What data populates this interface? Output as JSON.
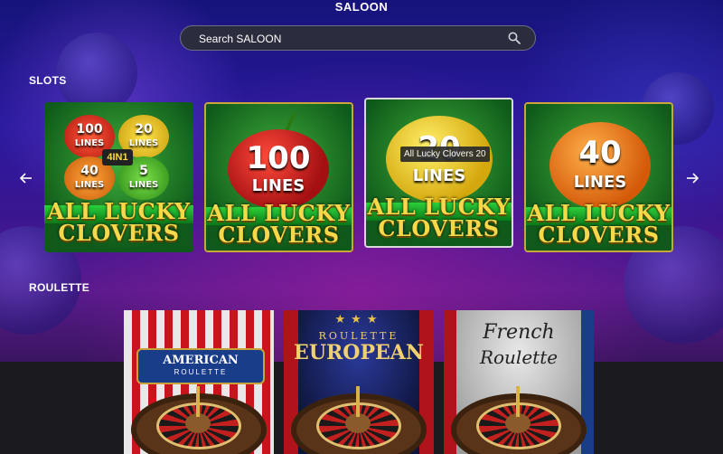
{
  "page_title": "SALOON",
  "search": {
    "placeholder": "Search SALOON"
  },
  "sections": {
    "slots_label": "SLOTS",
    "roulette_label": "ROULETTE"
  },
  "slots": [
    {
      "name": "All Lucky Clovers 5",
      "logo_line1": "ALL LUCKY",
      "logo_line2": "CLOVERS",
      "badges": [
        "100",
        "20",
        "40",
        "5"
      ],
      "badge_suffix": "LINES",
      "center": "4IN1"
    },
    {
      "name": "All Lucky Clovers 100",
      "logo_line1": "ALL LUCKY",
      "logo_line2": "CLOVERS",
      "number": "100",
      "unit": "LINES"
    },
    {
      "name": "All Lucky Clovers 20",
      "logo_line1": "ALL LUCKY",
      "logo_line2": "CLOVERS",
      "number": "20",
      "unit": "LINES"
    },
    {
      "name": "All Lucky Clovers 40",
      "logo_line1": "ALL LUCKY",
      "logo_line2": "CLOVERS",
      "number": "40",
      "unit": "LINES"
    }
  ],
  "tooltip": "All Lucky Clovers 20",
  "roulette": [
    {
      "line1": "AMERICAN",
      "line2": "ROULETTE"
    },
    {
      "line1": "ROULETTE",
      "line2": "EUROPEAN"
    },
    {
      "line1": "French",
      "line2": "Roulette"
    }
  ],
  "icons": {
    "search": "search-icon",
    "prev": "arrow-left-icon",
    "next": "arrow-right-icon"
  },
  "colors": {
    "background": "#2a1a9e",
    "search_bg": "#2b2d3e",
    "gold": "#f5d94a"
  }
}
